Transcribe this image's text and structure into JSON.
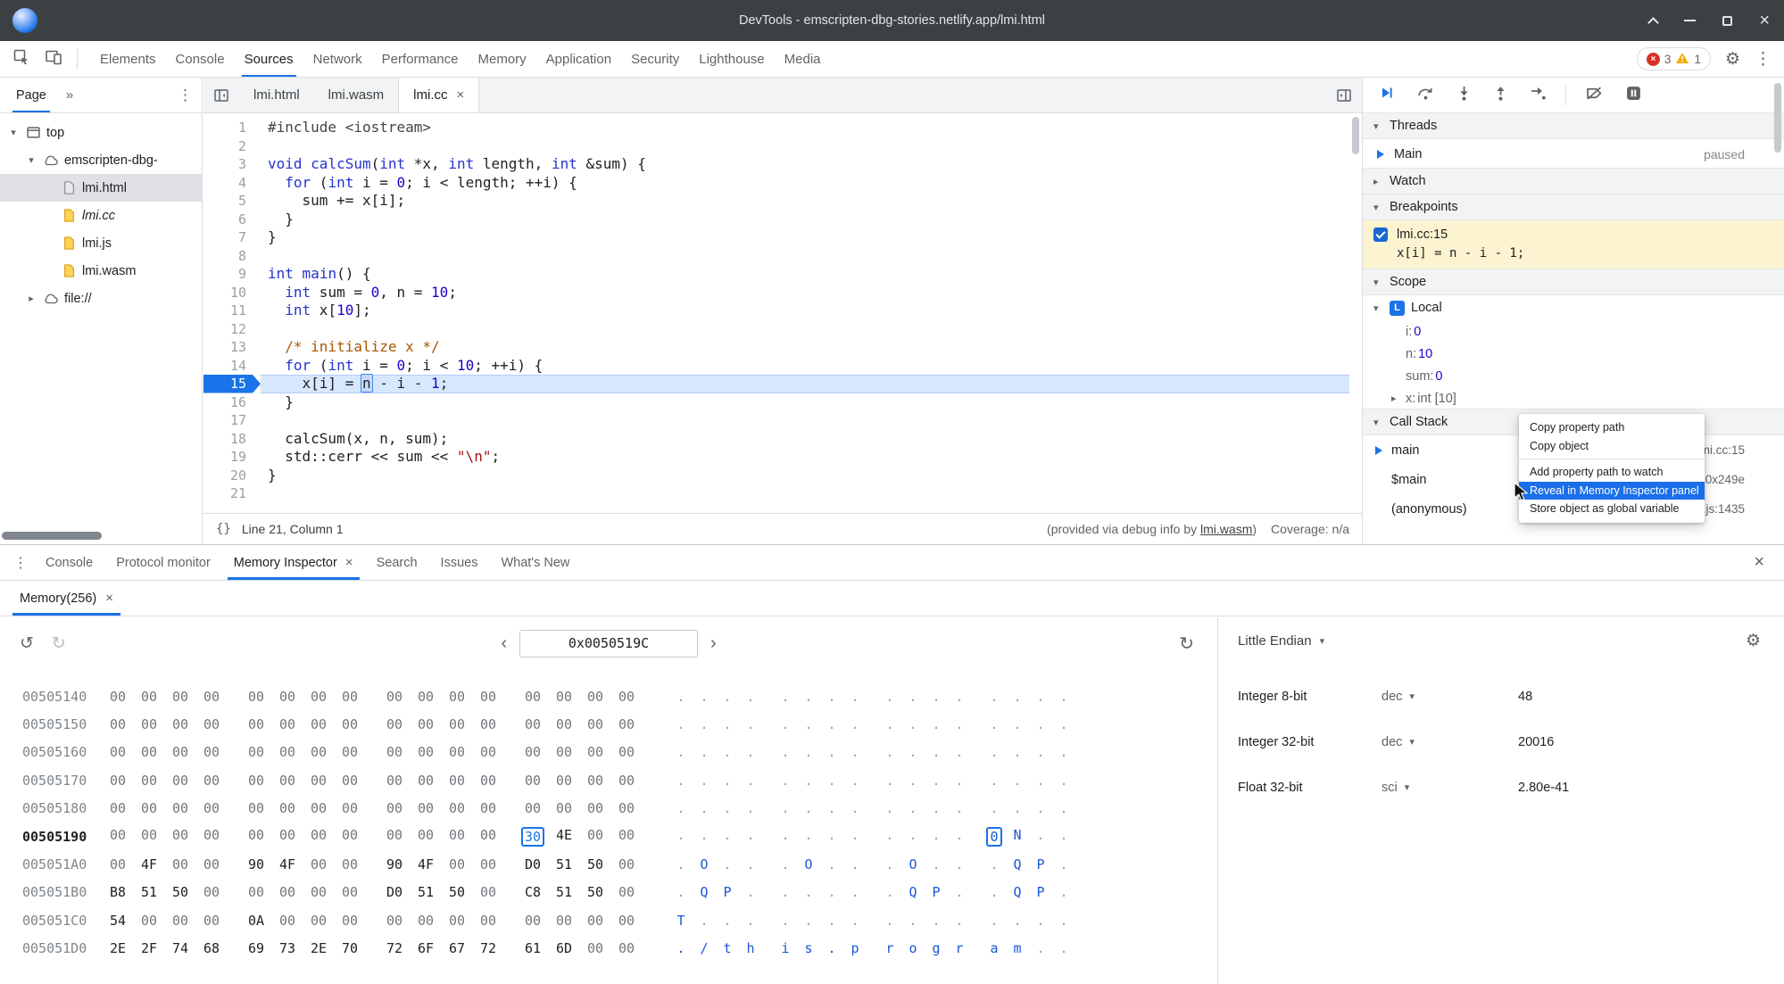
{
  "titlebar": {
    "title": "DevTools - emscripten-dbg-stories.netlify.app/lmi.html"
  },
  "icons": {
    "gear": "⚙",
    "kebab": "⋮",
    "more_tabs": "»",
    "close": "×",
    "chevron_left": "‹",
    "chevron_right": "›",
    "refresh": "↻",
    "history_back": "↺",
    "history_forward": "↻",
    "caret_down": "▾",
    "caret_right": "▸",
    "braces": "{}"
  },
  "theme": {
    "accent": "#1a73e8",
    "error": "#d93025",
    "warning": "#f9ab00",
    "paused_breakpoint_bg": "#fcf3d0",
    "exec_line_bg": "#d7e7fd"
  },
  "toolbar": {
    "tabs": [
      {
        "label": "Elements"
      },
      {
        "label": "Console"
      },
      {
        "label": "Sources",
        "active": true
      },
      {
        "label": "Network"
      },
      {
        "label": "Performance"
      },
      {
        "label": "Memory"
      },
      {
        "label": "Application"
      },
      {
        "label": "Security"
      },
      {
        "label": "Lighthouse"
      },
      {
        "label": "Media"
      }
    ],
    "error_count": "3",
    "warning_count": "1"
  },
  "navigator": {
    "tab_label": "Page",
    "tree": [
      {
        "label": "top",
        "icon": "frame",
        "depth": 0,
        "state": "expanded"
      },
      {
        "label": "emscripten-dbg-",
        "icon": "cloud",
        "depth": 1,
        "state": "expanded"
      },
      {
        "label": "lmi.html",
        "icon": "doc-gray",
        "depth": 2,
        "state": "leaf",
        "selected": true
      },
      {
        "label": "lmi.cc",
        "icon": "doc-yellow",
        "depth": 2,
        "state": "leaf",
        "italic": true
      },
      {
        "label": "lmi.js",
        "icon": "doc-yellow",
        "depth": 2,
        "state": "leaf"
      },
      {
        "label": "lmi.wasm",
        "icon": "doc-yellow",
        "depth": 2,
        "state": "leaf"
      },
      {
        "label": "file://",
        "icon": "cloud",
        "depth": 1,
        "state": "collapsed"
      }
    ]
  },
  "editor": {
    "tabs": [
      {
        "label": "lmi.html"
      },
      {
        "label": "lmi.wasm"
      },
      {
        "label": "lmi.cc",
        "active": true,
        "closable": true
      }
    ],
    "active_line": 15,
    "lines": [
      [
        [
          "meta",
          "#include <iostream>"
        ]
      ],
      [],
      [
        [
          "kw",
          "void"
        ],
        [
          "pl",
          " "
        ],
        [
          "def",
          "calcSum"
        ],
        [
          "pl",
          "("
        ],
        [
          "kw",
          "int"
        ],
        [
          "pl",
          " *x, "
        ],
        [
          "kw",
          "int"
        ],
        [
          "pl",
          " length, "
        ],
        [
          "kw",
          "int"
        ],
        [
          "pl",
          " &sum) {"
        ]
      ],
      [
        [
          "pl",
          "  "
        ],
        [
          "kw",
          "for"
        ],
        [
          "pl",
          " ("
        ],
        [
          "kw",
          "int"
        ],
        [
          "pl",
          " i = "
        ],
        [
          "num",
          "0"
        ],
        [
          "pl",
          "; i < length; ++i) {"
        ]
      ],
      [
        [
          "pl",
          "    sum += x[i];"
        ]
      ],
      [
        [
          "pl",
          "  }"
        ]
      ],
      [
        [
          "pl",
          "}"
        ]
      ],
      [],
      [
        [
          "kw",
          "int"
        ],
        [
          "pl",
          " "
        ],
        [
          "def",
          "main"
        ],
        [
          "pl",
          "() {"
        ]
      ],
      [
        [
          "pl",
          "  "
        ],
        [
          "kw",
          "int"
        ],
        [
          "pl",
          " sum = "
        ],
        [
          "num",
          "0"
        ],
        [
          "pl",
          ", n = "
        ],
        [
          "num",
          "10"
        ],
        [
          "pl",
          ";"
        ]
      ],
      [
        [
          "pl",
          "  "
        ],
        [
          "kw",
          "int"
        ],
        [
          "pl",
          " x["
        ],
        [
          "num",
          "10"
        ],
        [
          "pl",
          "];"
        ]
      ],
      [],
      [
        [
          "pl",
          "  "
        ],
        [
          "com",
          "/* initialize x */"
        ]
      ],
      [
        [
          "pl",
          "  "
        ],
        [
          "kw",
          "for"
        ],
        [
          "pl",
          " ("
        ],
        [
          "kw",
          "int"
        ],
        [
          "pl",
          " i = "
        ],
        [
          "num",
          "0"
        ],
        [
          "pl",
          "; i < "
        ],
        [
          "num",
          "10"
        ],
        [
          "pl",
          "; ++i) {"
        ]
      ],
      [
        [
          "pl",
          "    x[i] = "
        ],
        [
          "sel",
          "n"
        ],
        [
          "pl",
          " - i - "
        ],
        [
          "num",
          "1"
        ],
        [
          "pl",
          ";"
        ]
      ],
      [
        [
          "pl",
          "  }"
        ]
      ],
      [],
      [
        [
          "pl",
          "  calcSum(x, n, sum);"
        ]
      ],
      [
        [
          "pl",
          "  std::cerr << sum << "
        ],
        [
          "str",
          "\"\\n\""
        ],
        [
          "pl",
          ";"
        ]
      ],
      [
        [
          "pl",
          "}"
        ]
      ],
      []
    ],
    "status": {
      "line_col": "Line 21, Column 1",
      "debug_prefix": "(provided via debug info by ",
      "debug_link": "lmi.wasm",
      "debug_suffix": ")",
      "coverage": "Coverage: n/a"
    }
  },
  "debugger": {
    "threads": {
      "title": "Threads",
      "name": "Main",
      "status": "paused"
    },
    "watch": {
      "title": "Watch"
    },
    "breakpoints": {
      "title": "Breakpoints",
      "items": [
        {
          "checked": true,
          "location": "lmi.cc:15",
          "code": "x[i] = n - i - 1;"
        }
      ]
    },
    "scope": {
      "title": "Scope",
      "group": {
        "badge": "L",
        "name": "Local"
      },
      "vars": [
        {
          "name": "i",
          "value": "0",
          "kind": "number"
        },
        {
          "name": "n",
          "value": "10",
          "kind": "number"
        },
        {
          "name": "sum",
          "value": "0",
          "kind": "number"
        },
        {
          "name": "x",
          "value": "int [10]",
          "kind": "type",
          "expandable": true
        }
      ]
    },
    "callstack": {
      "title": "Call Stack",
      "frames": [
        {
          "name": "main",
          "loc": "lmi.cc:15",
          "current": true
        },
        {
          "name": "$main",
          "loc": "lmi.wasm:0x249e"
        },
        {
          "name": "(anonymous)",
          "loc": "lmi.js:1435"
        }
      ]
    }
  },
  "context_menu": {
    "items": [
      {
        "label": "Copy property path"
      },
      {
        "label": "Copy object",
        "divider_after": true
      },
      {
        "label": "Add property path to watch"
      },
      {
        "label": "Reveal in Memory Inspector panel",
        "highlighted": true
      },
      {
        "label": "Store object as global variable"
      }
    ]
  },
  "drawer": {
    "tabs": [
      {
        "label": "Console"
      },
      {
        "label": "Protocol monitor"
      },
      {
        "label": "Memory Inspector",
        "active": true,
        "closable": true
      },
      {
        "label": "Search"
      },
      {
        "label": "Issues"
      },
      {
        "label": "What's New"
      }
    ],
    "memory_tab_label": "Memory(256)",
    "address": "0x0050519C",
    "endianness": "Little Endian",
    "value_rows": [
      {
        "label": "Integer 8-bit",
        "format": "dec",
        "value": "48"
      },
      {
        "label": "Integer 32-bit",
        "format": "dec",
        "value": "20016"
      },
      {
        "label": "Float 32-bit",
        "format": "sci",
        "value": "2.80e-41"
      }
    ],
    "memory": {
      "selection": {
        "row": 5,
        "byte": 12
      },
      "rows": [
        {
          "address": "00505140",
          "bytes": [
            "00",
            "00",
            "00",
            "00",
            "00",
            "00",
            "00",
            "00",
            "00",
            "00",
            "00",
            "00",
            "00",
            "00",
            "00",
            "00"
          ]
        },
        {
          "address": "00505150",
          "bytes": [
            "00",
            "00",
            "00",
            "00",
            "00",
            "00",
            "00",
            "00",
            "00",
            "00",
            "00",
            "00",
            "00",
            "00",
            "00",
            "00"
          ]
        },
        {
          "address": "00505160",
          "bytes": [
            "00",
            "00",
            "00",
            "00",
            "00",
            "00",
            "00",
            "00",
            "00",
            "00",
            "00",
            "00",
            "00",
            "00",
            "00",
            "00"
          ]
        },
        {
          "address": "00505170",
          "bytes": [
            "00",
            "00",
            "00",
            "00",
            "00",
            "00",
            "00",
            "00",
            "00",
            "00",
            "00",
            "00",
            "00",
            "00",
            "00",
            "00"
          ]
        },
        {
          "address": "00505180",
          "bytes": [
            "00",
            "00",
            "00",
            "00",
            "00",
            "00",
            "00",
            "00",
            "00",
            "00",
            "00",
            "00",
            "00",
            "00",
            "00",
            "00"
          ]
        },
        {
          "address": "00505190",
          "bytes": [
            "00",
            "00",
            "00",
            "00",
            "00",
            "00",
            "00",
            "00",
            "00",
            "00",
            "00",
            "00",
            "30",
            "4E",
            "00",
            "00"
          ]
        },
        {
          "address": "005051A0",
          "bytes": [
            "00",
            "4F",
            "00",
            "00",
            "90",
            "4F",
            "00",
            "00",
            "90",
            "4F",
            "00",
            "00",
            "D0",
            "51",
            "50",
            "00"
          ]
        },
        {
          "address": "005051B0",
          "bytes": [
            "B8",
            "51",
            "50",
            "00",
            "00",
            "00",
            "00",
            "00",
            "D0",
            "51",
            "50",
            "00",
            "C8",
            "51",
            "50",
            "00"
          ]
        },
        {
          "address": "005051C0",
          "bytes": [
            "54",
            "00",
            "00",
            "00",
            "0A",
            "00",
            "00",
            "00",
            "00",
            "00",
            "00",
            "00",
            "00",
            "00",
            "00",
            "00"
          ]
        },
        {
          "address": "005051D0",
          "bytes": [
            "2E",
            "2F",
            "74",
            "68",
            "69",
            "73",
            "2E",
            "70",
            "72",
            "6F",
            "67",
            "72",
            "61",
            "6D",
            "00",
            "00"
          ]
        }
      ]
    }
  }
}
